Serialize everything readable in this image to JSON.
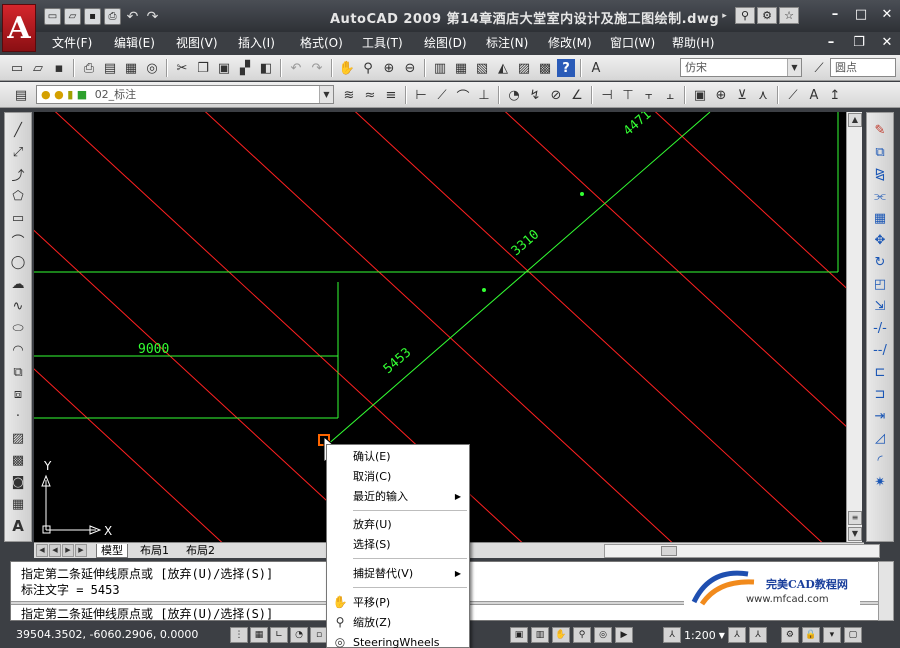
{
  "window": {
    "title": "AutoCAD 2009 第14章酒店大堂室内设计及施工图绘制.dwg",
    "logo_letter": "A"
  },
  "menu": {
    "items": [
      "文件(F)",
      "编辑(E)",
      "视图(V)",
      "插入(I)",
      "格式(O)",
      "工具(T)",
      "绘图(D)",
      "标注(N)",
      "修改(M)",
      "窗口(W)",
      "帮助(H)"
    ]
  },
  "toolbar": {
    "text_style": "仿宋",
    "dim_style": "圆点",
    "layer": "02_标注"
  },
  "drawing": {
    "dim_9000": "9000",
    "dim_5453": "5453",
    "dim_3310": "3310",
    "dim_4471": "4471",
    "ucs_y": "Y",
    "ucs_x": "X",
    "colors": {
      "background": "#000000",
      "hatch": "#ff2020",
      "dims": "#33ff33",
      "grips": "#ff6600"
    }
  },
  "layout_tabs": [
    "模型",
    "布局1",
    "布局2"
  ],
  "command": {
    "line1": "指定第二条延伸线原点或 [放弃(U)/选择(S)]",
    "line2": "标注文字 = 5453",
    "prompt": "指定第二条延伸线原点或 [放弃(U)/选择(S)]"
  },
  "watermark": {
    "title": "完美CAD教程网",
    "url": "www.mfcad.com"
  },
  "status": {
    "coords": "39504.3502, -6060.2906, 0.0000",
    "annotation_scale": "1:200"
  },
  "context_menu": {
    "items": [
      {
        "label": "确认(E)",
        "submenu": false
      },
      {
        "label": "取消(C)",
        "submenu": false
      },
      {
        "label": "最近的输入",
        "submenu": true
      },
      {
        "label": "放弃(U)",
        "submenu": false
      },
      {
        "label": "选择(S)",
        "submenu": false
      },
      {
        "label": "捕捉替代(V)",
        "submenu": true
      },
      {
        "label": "平移(P)",
        "submenu": false
      },
      {
        "label": "缩放(Z)",
        "submenu": false
      },
      {
        "label": "SteeringWheels",
        "submenu": false
      }
    ]
  }
}
